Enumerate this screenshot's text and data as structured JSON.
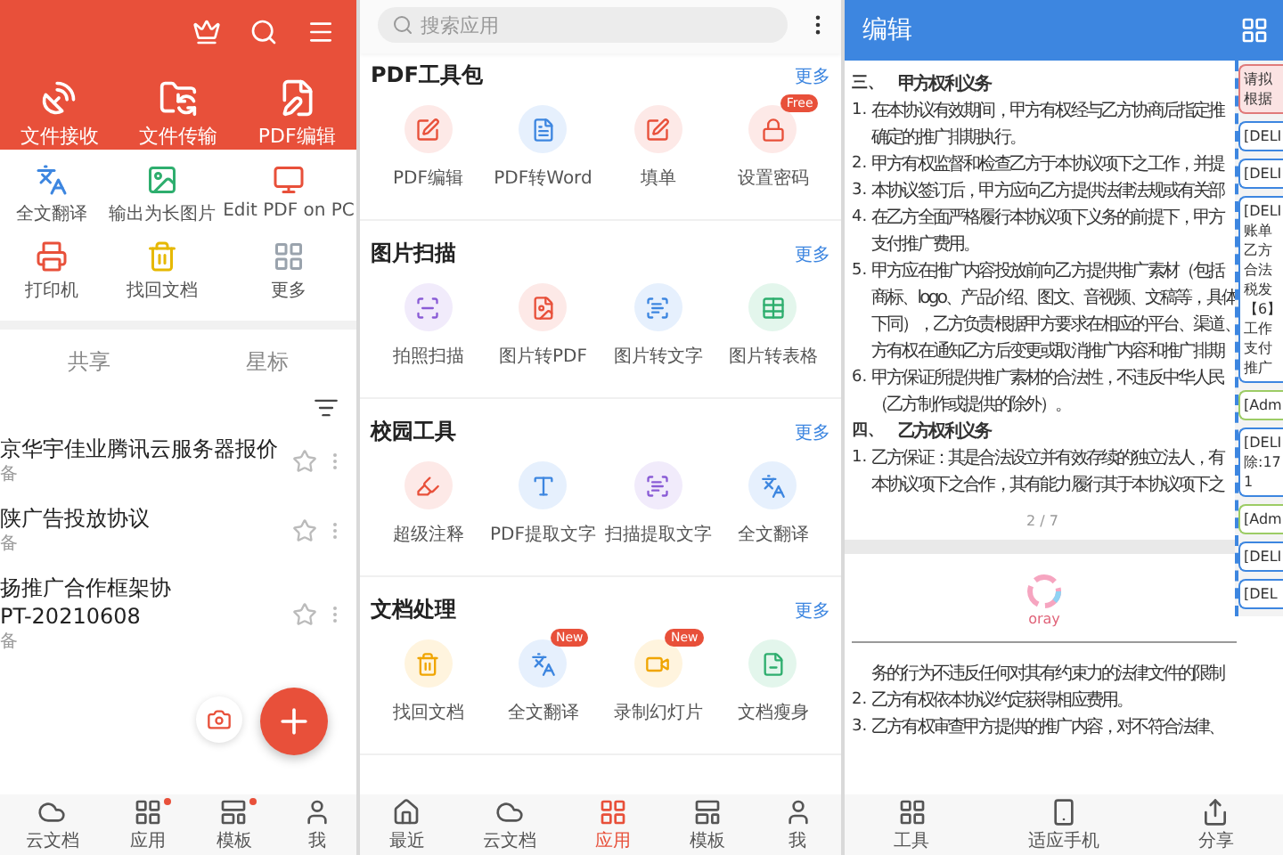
{
  "left_panel": {
    "header_actions": [
      {
        "label": "文件接收"
      },
      {
        "label": "文件传输"
      },
      {
        "label": "PDF编辑"
      }
    ],
    "tools": [
      {
        "label": "全文翻译"
      },
      {
        "label": "输出为长图片"
      },
      {
        "label": "Edit PDF on PC"
      },
      {
        "label": "打印机"
      },
      {
        "label": "找回文档"
      },
      {
        "label": "更多"
      }
    ],
    "tabs": [
      {
        "label": "共享",
        "selected": false
      },
      {
        "label": "星标",
        "selected": false
      }
    ],
    "files": [
      {
        "title_lines": [
          "京华宇佳业腾讯云服务器报价"
        ],
        "subtitle": "备",
        "starred": false
      },
      {
        "title_lines": [
          "陕广告投放协议"
        ],
        "subtitle": "备",
        "starred": false
      },
      {
        "title_lines": [
          "扬推广合作框架协",
          "PT-20210608"
        ],
        "subtitle": "备",
        "starred": false
      }
    ],
    "bottom_nav": [
      {
        "label": "云文档",
        "selected": false,
        "dot": false
      },
      {
        "label": "应用",
        "selected": false,
        "dot": true
      },
      {
        "label": "模板",
        "selected": false,
        "dot": true
      },
      {
        "label": "我",
        "selected": false,
        "dot": false
      }
    ]
  },
  "middle_panel": {
    "search": {
      "placeholder": "搜索应用"
    },
    "sections": [
      {
        "title": "PDF工具包",
        "more": "更多",
        "items": [
          {
            "label": "PDF编辑"
          },
          {
            "label": "PDF转Word"
          },
          {
            "label": "填单"
          },
          {
            "label": "设置密码",
            "badge": "Free"
          }
        ]
      },
      {
        "title": "图片扫描",
        "more": "更多",
        "items": [
          {
            "label": "拍照扫描"
          },
          {
            "label": "图片转PDF"
          },
          {
            "label": "图片转文字"
          },
          {
            "label": "图片转表格"
          }
        ]
      },
      {
        "title": "校园工具",
        "more": "更多",
        "items": [
          {
            "label": "超级注释"
          },
          {
            "label": "PDF提取文字"
          },
          {
            "label": "扫描提取文字"
          },
          {
            "label": "全文翻译"
          }
        ]
      },
      {
        "title": "文档处理",
        "more": "更多",
        "items": [
          {
            "label": "找回文档"
          },
          {
            "label": "全文翻译",
            "badge": "New"
          },
          {
            "label": "录制幻灯片",
            "badge": "New"
          },
          {
            "label": "文档瘦身"
          }
        ]
      }
    ],
    "bottom_nav": [
      {
        "label": "最近",
        "selected": false
      },
      {
        "label": "云文档",
        "selected": false
      },
      {
        "label": "应用",
        "selected": true
      },
      {
        "label": "模板",
        "selected": false
      },
      {
        "label": "我",
        "selected": false
      }
    ]
  },
  "right_panel": {
    "title": "编辑",
    "page_one": [
      {
        "kind": "heading",
        "num": "三、",
        "text": "甲方权利义务"
      },
      {
        "kind": "item",
        "num": "1.",
        "text": "在本协议有效期间，甲方有权经与乙方协商后指定推"
      },
      {
        "kind": "cont",
        "text": "确定的推广排期执行。"
      },
      {
        "kind": "item",
        "num": "2.",
        "text": "甲方有权监督和检查乙方于本协议项下之工作，并提"
      },
      {
        "kind": "item",
        "num": "3.",
        "text": "本协议签订后，甲方应向乙方提供法律法规或有关部"
      },
      {
        "kind": "item",
        "num": "4.",
        "text": "在乙方全面严格履行本协议项下义务的前提下，甲方"
      },
      {
        "kind": "cont",
        "text": "支付推广费用。"
      },
      {
        "kind": "item",
        "num": "5.",
        "text": "甲方应在推广内容投放前向乙方提供推广素材（包括"
      },
      {
        "kind": "cont",
        "text": "商标、logo、产品介绍、图文、音视频、文稿等，具体"
      },
      {
        "kind": "cont",
        "text": "下同），乙方负责根据甲方要求在相应的平台、渠道、"
      },
      {
        "kind": "cont",
        "text": "方有权在通知乙方后变更或取消推广内容和推广排期"
      },
      {
        "kind": "item",
        "num": "6.",
        "text": "甲方保证所提供推广素材的合法性，不违反中华人民"
      },
      {
        "kind": "cont",
        "text": "（乙方制作或提供的除外）。"
      },
      {
        "kind": "heading",
        "num": "四、",
        "text": "乙方权利义务"
      },
      {
        "kind": "item",
        "num": "1.",
        "text": "乙方保证：其是合法设立并有效存续的独立法人，有"
      },
      {
        "kind": "cont",
        "text": "本协议项下之合作，其有能力履行其于本协议项下之"
      }
    ],
    "page_number": "2 / 7",
    "loading_text": "oray",
    "page_two": [
      {
        "kind": "cont",
        "text": "务的行为不违反任何对其有约束力的法律文件的限制"
      },
      {
        "kind": "item",
        "num": "2.",
        "text": "乙方有权依本协议约定获得相应费用。"
      },
      {
        "kind": "item",
        "num": "3.",
        "text": "乙方有权审查甲方提供的推广内容，对不符合法律、"
      }
    ],
    "comments": [
      {
        "kind": "reject",
        "lines": [
          "请拟",
          "根据"
        ]
      },
      {
        "kind": "delete",
        "lines": [
          "[DELI"
        ]
      },
      {
        "kind": "delete",
        "lines": [
          "[DELI"
        ]
      },
      {
        "kind": "delete",
        "lines": [
          "[DELI",
          "账单",
          "乙方",
          "合法",
          "税发",
          "【6】",
          "工作",
          "支付",
          "推广"
        ]
      },
      {
        "kind": "admin",
        "lines": [
          "[Adm"
        ]
      },
      {
        "kind": "delete",
        "lines": [
          "[DELI",
          "除:17",
          "1"
        ]
      },
      {
        "kind": "admin",
        "lines": [
          "[Adm"
        ]
      },
      {
        "kind": "delete",
        "lines": [
          "[DELI"
        ]
      },
      {
        "kind": "delete",
        "lines": [
          "[DEL"
        ]
      }
    ],
    "toolbar": [
      {
        "label": "工具"
      },
      {
        "label": "适应手机"
      },
      {
        "label": "分享"
      }
    ]
  }
}
